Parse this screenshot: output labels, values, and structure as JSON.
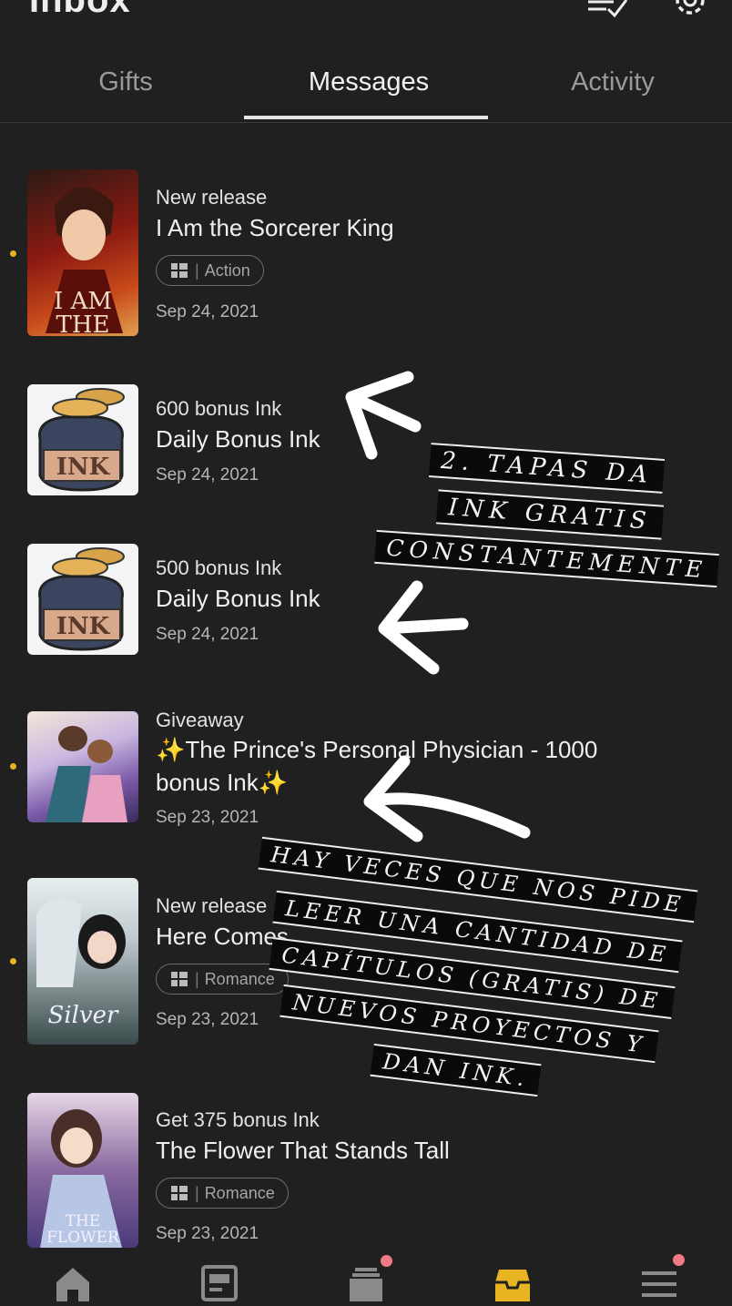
{
  "header": {
    "title": "Inbox"
  },
  "tabs": [
    {
      "label": "Gifts"
    },
    {
      "label": "Messages"
    },
    {
      "label": "Activity"
    }
  ],
  "messages": [
    {
      "kicker": "New release",
      "title": "I Am the Sorcerer King",
      "tag": "Action",
      "date": "Sep 24, 2021",
      "unread": true,
      "cover_text": "I AM THE Sorcerer"
    },
    {
      "kicker": "600 bonus Ink",
      "title": "Daily Bonus Ink",
      "date": "Sep 24, 2021",
      "unread": false,
      "cover_text": "INK"
    },
    {
      "kicker": "500 bonus Ink",
      "title": "Daily Bonus Ink",
      "date": "Sep 24, 2021",
      "unread": false,
      "cover_text": "INK"
    },
    {
      "kicker": "Giveaway",
      "title": "✨The Prince's Personal Physician - 1000 bonus Ink✨",
      "date": "Sep 23, 2021",
      "unread": true
    },
    {
      "kicker": "New release",
      "title": "Here Comes",
      "tag": "Romance",
      "date": "Sep 23, 2021",
      "unread": true,
      "cover_text": "Silver"
    },
    {
      "kicker": "Get 375 bonus Ink",
      "title": "The Flower That Stands Tall",
      "tag": "Romance",
      "date": "Sep 23, 2021",
      "unread": false,
      "cover_text": "THE FLOWER"
    }
  ],
  "annotations": {
    "note1": [
      "2. TAPAS DA",
      "INK GRATIS",
      "CONSTANTEMENTE"
    ],
    "note2": [
      "HAY VECES QUE NOS PIDE",
      "LEER UNA CANTIDAD DE",
      "CAPÍTULOS (GRATIS) DE",
      "NUEVOS PROYECTOS Y",
      "DAN INK."
    ]
  },
  "bottom_nav": [
    {
      "icon": "home-icon",
      "badge": false
    },
    {
      "icon": "library-icon",
      "badge": false
    },
    {
      "icon": "stack-icon",
      "badge": true
    },
    {
      "icon": "inbox-icon",
      "badge": false,
      "active": true
    },
    {
      "icon": "menu-icon",
      "badge": true
    }
  ],
  "colors": {
    "background": "#202020",
    "accent": "#e9b422",
    "badge": "#f07a86"
  }
}
